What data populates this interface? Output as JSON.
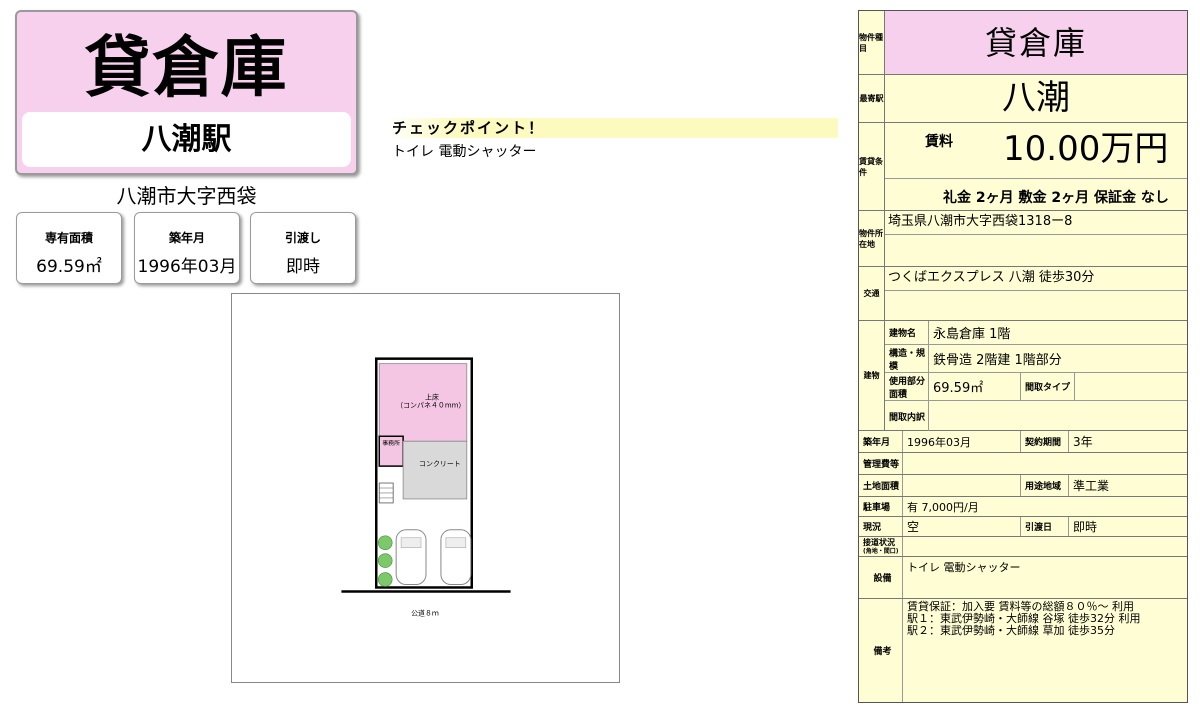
{
  "hero": {
    "type": "貸倉庫",
    "station": "八潮駅"
  },
  "address_short": "八潮市大字西袋",
  "info_cards": [
    {
      "label": "専有面積",
      "value": "69.59㎡"
    },
    {
      "label": "築年月",
      "value": "1996年03月"
    },
    {
      "label": "引渡し",
      "value": "即時"
    }
  ],
  "checkpoint": {
    "title": "チェックポイント！",
    "text": "トイレ 電動シャッター"
  },
  "floor_plan": {
    "upper_floor": "上床",
    "upper_floor_note": "（コンパネ４０mm）",
    "office": "事務所",
    "concrete": "コンクリート",
    "road": "公道８ｍ"
  },
  "spec": {
    "labels": {
      "property_type": "物件種目",
      "nearest_station": "最寄駅",
      "rent_terms": "賃貸条件",
      "location": "物件所在地",
      "transport": "交通",
      "building": "建物",
      "building_name": "建物名",
      "structure": "構造・規模",
      "usage_area": "使用部分面積",
      "layout_type": "間取タイプ",
      "layout_detail": "間取内訳",
      "built": "築年月",
      "contract_period": "契約期間",
      "management_fee": "管理費等",
      "land_area": "土地面積",
      "zoning": "用途地域",
      "parking": "駐車場",
      "status": "現況",
      "handover": "引渡日",
      "road_access": "接道状況",
      "road_access_sub": "(角地・間口)",
      "equipment": "設備",
      "remarks": "備考",
      "rent": "賃料"
    },
    "property_type": "貸倉庫",
    "nearest_station": "八潮",
    "rent": "10.00万円",
    "fees": "礼金 2ヶ月  敷金 2ヶ月  保証金 なし",
    "location": "埼玉県八潮市大字西袋1318ー8",
    "transport": "つくばエクスプレス 八潮 徒歩30分",
    "building_name": "永島倉庫  1階",
    "structure": "鉄骨造 2階建 1階部分",
    "usage_area": "69.59㎡",
    "built": "1996年03月",
    "contract_period": "3年",
    "zoning": "準工業",
    "parking": "有  7,000円/月",
    "status": "空",
    "handover": "即時",
    "equipment": "トイレ 電動シャッター",
    "remarks": [
      "賃貸保証：加入要 賃料等の総額８０％～ 利用",
      "駅１：東武伊勢崎・大師線 谷塚 徒歩32分  利用",
      "駅２：東武伊勢崎・大師線 草加 徒歩35分"
    ]
  }
}
